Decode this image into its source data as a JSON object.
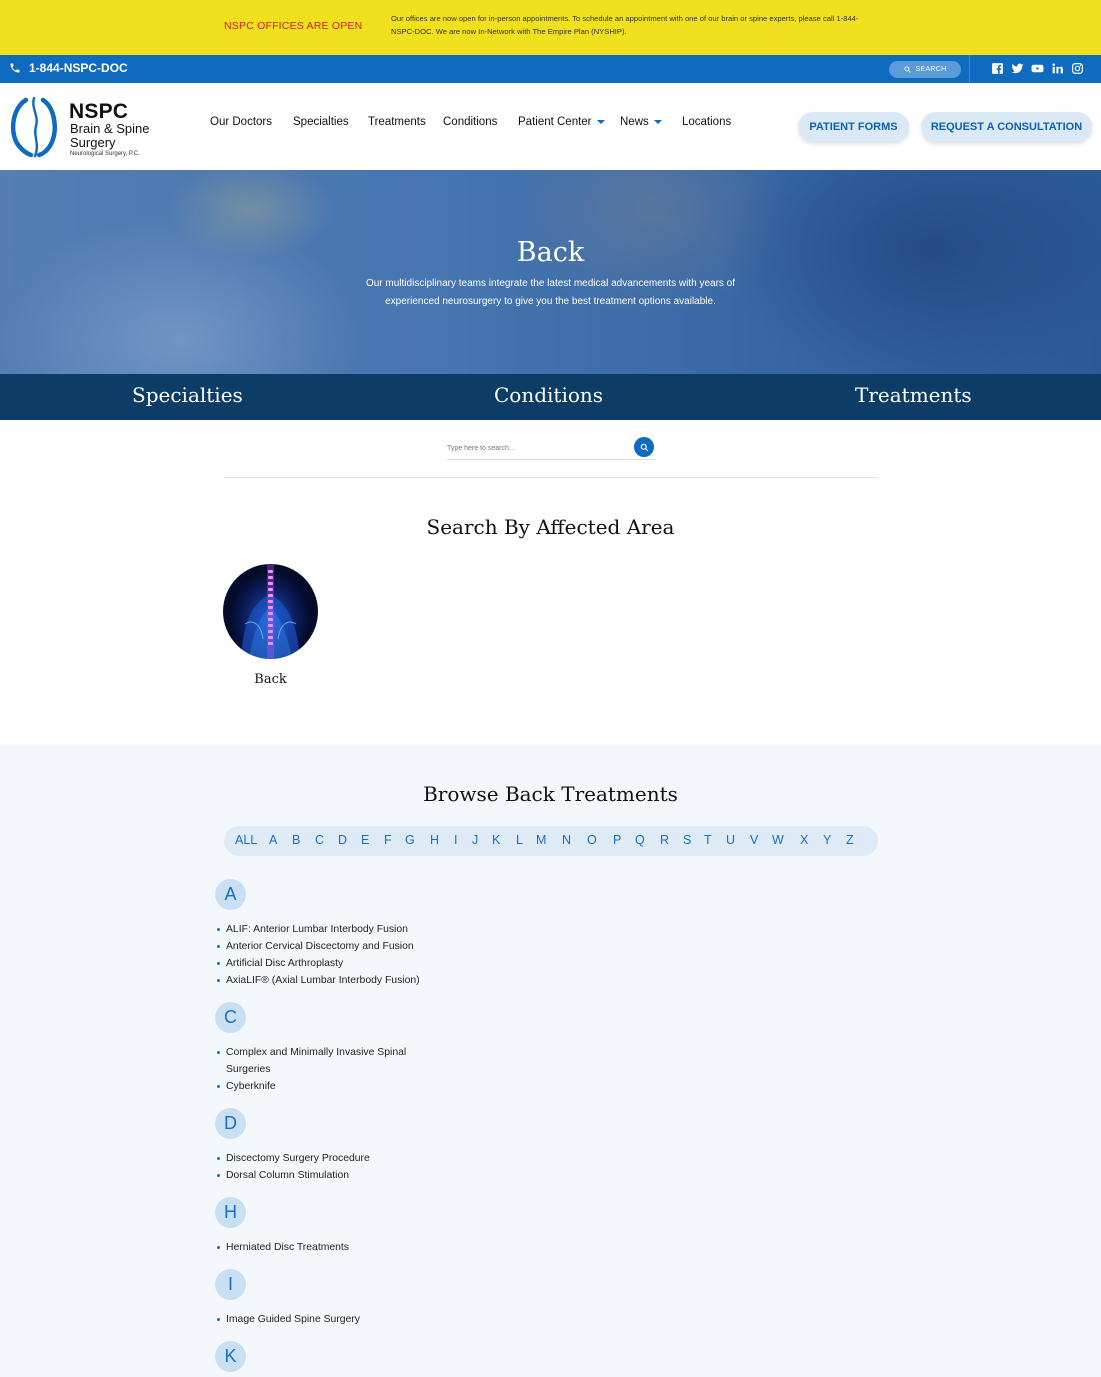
{
  "alert": {
    "title": "NSPC OFFICES ARE OPEN",
    "message": "Our offices are now open for in-person appointments. To schedule an appointment with one of our brain or spine experts, please call 1-844-NSPC-DOC. We are now In-Network with The Empire Plan (NYSHIP)."
  },
  "utility": {
    "phone": "1-844-NSPC-DOC",
    "search_label": "SEARCH",
    "socials": [
      "facebook-icon",
      "twitter-icon",
      "youtube-icon",
      "linkedin-icon",
      "instagram-icon"
    ]
  },
  "header": {
    "logo": {
      "name": "NSPC",
      "line1": "Brain & Spine",
      "line2": "Surgery",
      "line3": "Neurological Surgery, P.C."
    },
    "nav": [
      {
        "label": "Our Doctors"
      },
      {
        "label": "Specialties"
      },
      {
        "label": "Treatments"
      },
      {
        "label": "Conditions"
      },
      {
        "label": "Patient Center"
      },
      {
        "label": "News"
      },
      {
        "label": "Locations"
      }
    ],
    "patient_forms": "PATIENT FORMS",
    "request_consultation": "REQUEST A CONSULTATION"
  },
  "hero": {
    "title": "Back",
    "text": "Our multidisciplinary teams integrate the latest medical advancements with years of experienced neurosurgery to give you the best treatment options available."
  },
  "categories": [
    "Specialties",
    "Conditions",
    "Treatments"
  ],
  "search": {
    "placeholder": "Type here to search..."
  },
  "affected": {
    "heading": "Search By Affected Area",
    "items": [
      {
        "label": "Back"
      }
    ]
  },
  "browse": {
    "heading": "Browse Back Treatments",
    "alphabet": [
      "ALL",
      "A",
      "B",
      "C",
      "D",
      "E",
      "F",
      "G",
      "H",
      "I",
      "J",
      "K",
      "L",
      "M",
      "N",
      "O",
      "P",
      "Q",
      "R",
      "S",
      "T",
      "U",
      "V",
      "W",
      "X",
      "Y",
      "Z"
    ],
    "groups": [
      {
        "letter": "A",
        "items": [
          "ALIF: Anterior Lumbar Interbody Fusion",
          "Anterior Cervical Discectomy and Fusion",
          "Artificial Disc Arthroplasty",
          "AxiaLIF® (Axial Lumbar Interbody Fusion)"
        ]
      },
      {
        "letter": "C",
        "items": [
          "Complex and Minimally Invasive Spinal",
          "Surgeries",
          "Cyberknife"
        ]
      },
      {
        "letter": "D",
        "items": [
          "Discectomy Surgery Procedure",
          "Dorsal Column Stimulation"
        ]
      },
      {
        "letter": "H",
        "items": [
          "Herniated Disc Treatments"
        ]
      },
      {
        "letter": "I",
        "items": [
          "Image Guided Spine Surgery"
        ]
      },
      {
        "letter": "K",
        "items": []
      }
    ]
  },
  "colors": {
    "alert_bg": "#f0e01e",
    "brand_blue": "#0f6bc0",
    "navy": "#0d3d66",
    "alert_red": "#d1201c"
  }
}
